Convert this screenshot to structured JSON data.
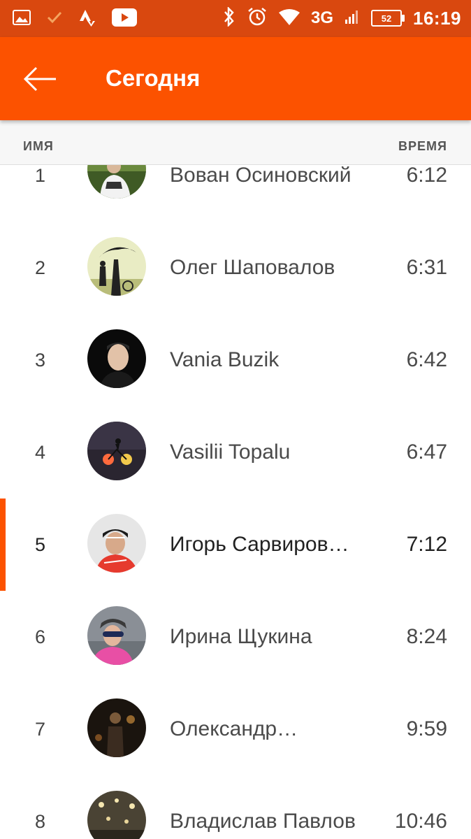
{
  "status_bar": {
    "time": "16:19",
    "network": "3G",
    "battery": "52",
    "icons": [
      "gallery-icon",
      "check-icon",
      "strava-icon",
      "youtube-icon",
      "bluetooth-icon",
      "alarm-icon",
      "wifi-icon",
      "signal-icon",
      "battery-icon"
    ]
  },
  "app_bar": {
    "title": "Сегодня",
    "back_icon": "arrow-left-icon",
    "color": "#fc5200"
  },
  "header": {
    "name_label": "ИМЯ",
    "time_label": "ВРЕМЯ"
  },
  "leaderboard": [
    {
      "rank": "1",
      "name": "Вован Осиновский",
      "time": "6:12"
    },
    {
      "rank": "2",
      "name": "Олег Шаповалов",
      "time": "6:31"
    },
    {
      "rank": "3",
      "name": "Vania Buzik",
      "time": "6:42"
    },
    {
      "rank": "4",
      "name": "Vasilii Topalu",
      "time": "6:47"
    },
    {
      "rank": "5",
      "name": "Игорь Сарвиров…",
      "time": "7:12",
      "highlighted": true
    },
    {
      "rank": "6",
      "name": "Ирина Щукина",
      "time": "8:24"
    },
    {
      "rank": "7",
      "name": "Олександр…",
      "time": "9:59"
    },
    {
      "rank": "8",
      "name": "Владислав Павлов",
      "time": "10:46"
    }
  ]
}
